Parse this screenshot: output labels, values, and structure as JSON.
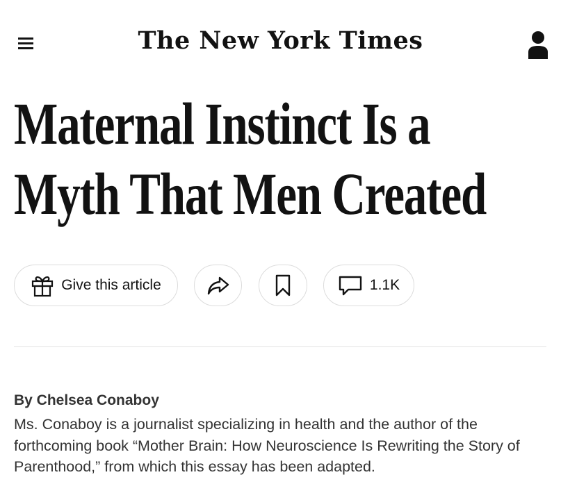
{
  "header": {
    "masthead": "The New York Times",
    "menu_icon": "hamburger-menu-icon",
    "account_icon": "account-person-icon"
  },
  "article": {
    "headline_line1": "Maternal Instinct Is a",
    "headline_line2": "Myth That Men Created",
    "actions": {
      "gift_label": "Give this article",
      "gift_icon": "gift-icon",
      "share_icon": "share-arrow-icon",
      "save_icon": "bookmark-icon",
      "comments_icon": "comment-bubble-icon",
      "comments_count": "1.1K"
    },
    "byline": "By Chelsea Conaboy",
    "bio": "Ms. Conaboy is a journalist specializing in health and the author of the forthcoming book “Mother Brain: How Neuroscience Is Rewriting the Story of Parenthood,” from which this essay has been adapted."
  }
}
